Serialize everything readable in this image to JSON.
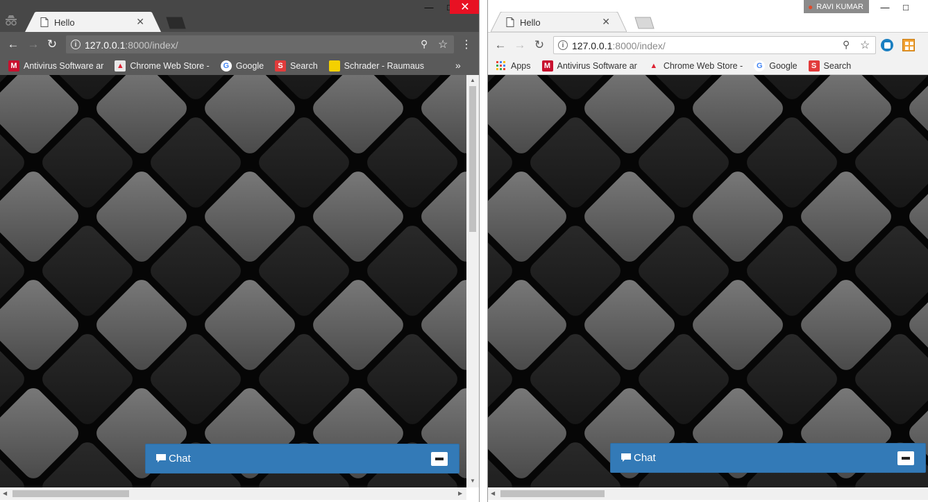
{
  "left": {
    "tab_title": "Hello",
    "url_host": "127.0.0.1",
    "url_path": ":8000/index/",
    "bookmarks": [
      {
        "label": "Antivirus Software ar",
        "icon": "mcafee-icon"
      },
      {
        "label": "Chrome Web Store -",
        "icon": "chrome-web-store-icon"
      },
      {
        "label": "Google",
        "icon": "google-icon"
      },
      {
        "label": "Search",
        "icon": "search-s-icon"
      },
      {
        "label": "Schrader - Raumaus",
        "icon": "schrader-icon"
      }
    ],
    "chat_label": "Chat"
  },
  "right": {
    "profile_name": "RAVI KUMAR",
    "tab_title": "Hello",
    "url_host": "127.0.0.1",
    "url_path": ":8000/index/",
    "bookmarks": [
      {
        "label": "Apps",
        "icon": "apps-grid-icon"
      },
      {
        "label": "Antivirus Software ar",
        "icon": "mcafee-icon"
      },
      {
        "label": "Chrome Web Store -",
        "icon": "chrome-web-store-icon"
      },
      {
        "label": "Google",
        "icon": "google-icon"
      },
      {
        "label": "Search",
        "icon": "search-s-icon"
      }
    ],
    "chat_label": "Chat"
  },
  "colors": {
    "chat_bar": "#337ab7",
    "incognito_frame": "#474747",
    "close_button": "#e81123"
  }
}
